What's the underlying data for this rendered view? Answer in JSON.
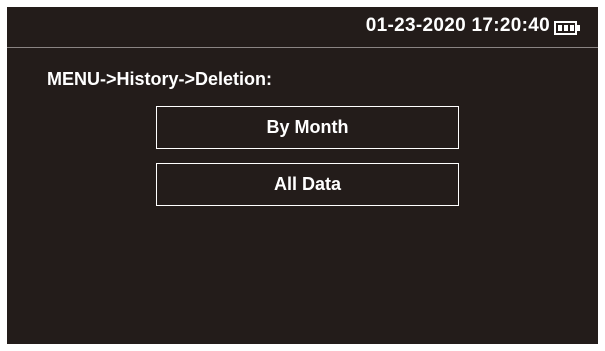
{
  "status_bar": {
    "datetime": "01-23-2020 17:20:40",
    "battery_icon": "battery-full-icon",
    "battery_level": "3/3"
  },
  "breadcrumb": "MENU->History->Deletion:",
  "menu": {
    "items": [
      {
        "label": "By Month"
      },
      {
        "label": "All Data"
      }
    ]
  },
  "colors": {
    "background": "#231c1a",
    "text": "#ffffff",
    "border": "#ffffff"
  }
}
